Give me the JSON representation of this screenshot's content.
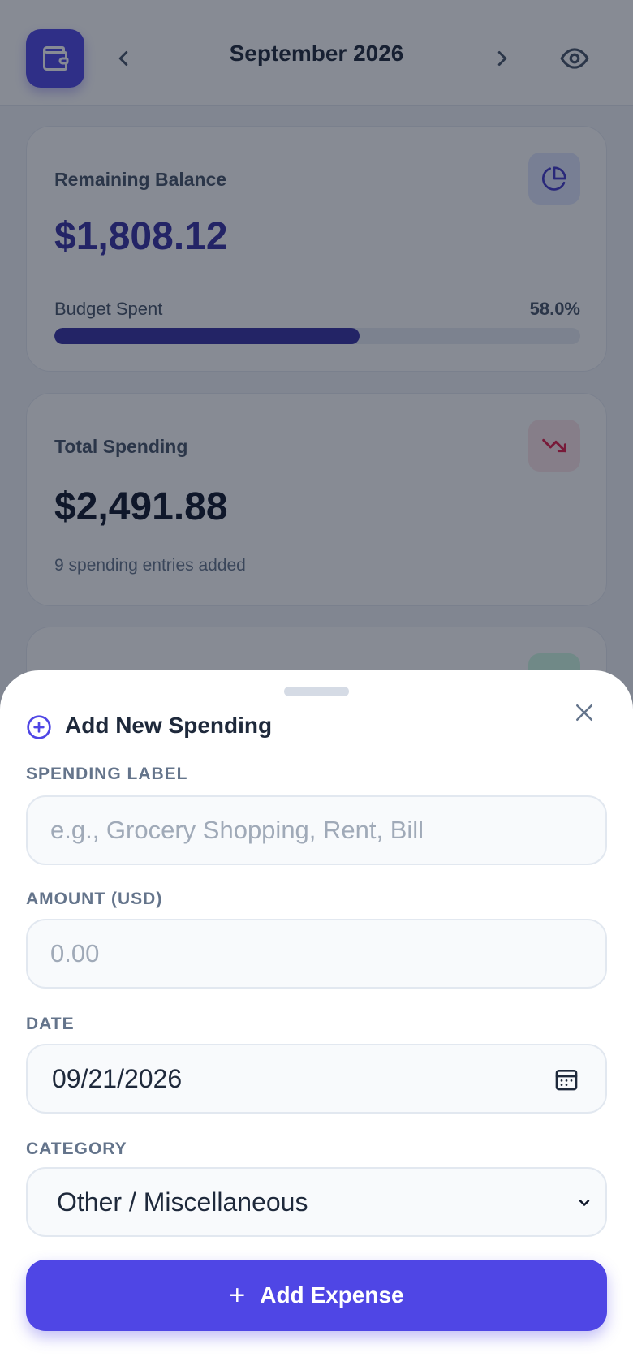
{
  "header": {
    "month": "September 2026"
  },
  "balance_card": {
    "label": "Remaining Balance",
    "value": "$1,808.12",
    "budget_label": "Budget Spent",
    "budget_percent_text": "58.0%",
    "budget_spent_fraction": 0.58
  },
  "spending_card": {
    "label": "Total Spending",
    "value": "$2,491.88",
    "entries_text": "9 spending entries added"
  },
  "sheet": {
    "title": "Add New Spending",
    "label_field": {
      "label": "SPENDING LABEL",
      "placeholder": "e.g., Grocery Shopping, Rent, Bill"
    },
    "amount_field": {
      "label": "AMOUNT (USD)",
      "placeholder": "0.00"
    },
    "date_field": {
      "label": "DATE",
      "value": "09/21/2026"
    },
    "category_field": {
      "label": "CATEGORY",
      "value": "Other / Miscellaneous"
    },
    "submit_label": "Add Expense"
  },
  "colors": {
    "accent": "#4f46e5",
    "balance_value": "#3730a3",
    "spending_icon": "#e11d48"
  },
  "icons": [
    "wallet-icon",
    "chevron-left-icon",
    "chevron-right-icon",
    "eye-icon",
    "pie-chart-icon",
    "trending-down-icon",
    "plus-circle-icon",
    "close-icon",
    "calendar-icon",
    "chevron-down-icon",
    "plus-icon"
  ]
}
